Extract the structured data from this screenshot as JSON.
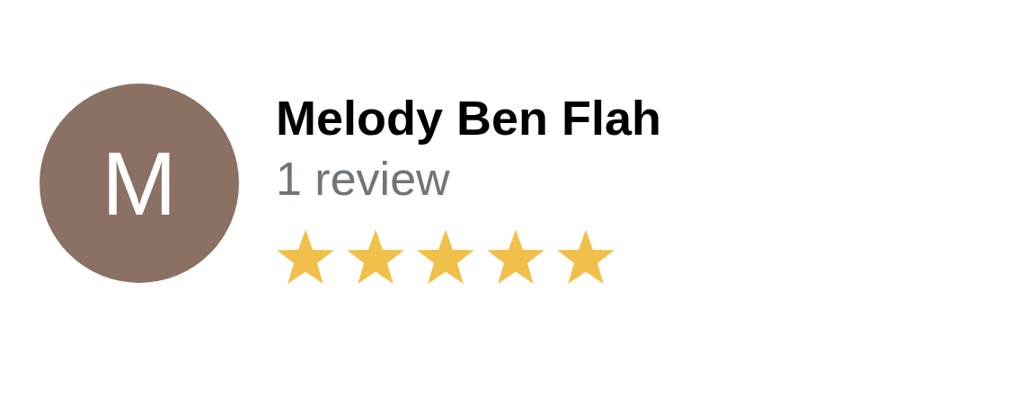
{
  "review": {
    "avatar_letter": "M",
    "name": "Melody Ben Flah",
    "review_count": "1 review",
    "stars": 5
  }
}
